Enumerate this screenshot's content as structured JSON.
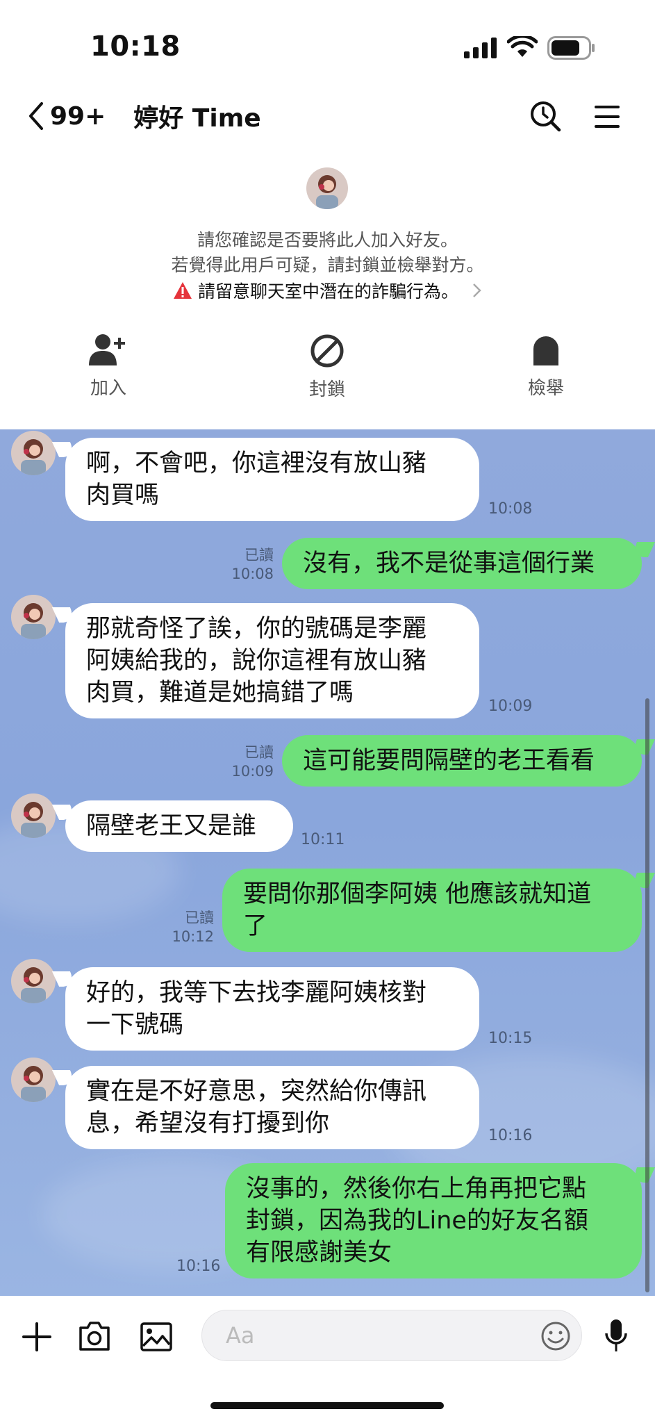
{
  "status_bar": {
    "time": "10:18"
  },
  "header": {
    "back_count": "99+",
    "title": "婷好 Time"
  },
  "notice": {
    "line1": "請您確認是否要將此人加入好友。",
    "line2": "若覺得此用戶可疑，請封鎖並檢舉對方。",
    "warning": "請留意聊天室中潛在的詐騙行為。"
  },
  "actions": {
    "add": "加入",
    "block": "封鎖",
    "report": "檢舉"
  },
  "messages": [
    {
      "side": "in",
      "text": "啊，不會吧，你這裡沒有放山豬\n肉買嗎",
      "time": "10:08"
    },
    {
      "side": "out",
      "text": "沒有，我不是從事這個行業",
      "read": "已讀",
      "time": "10:08"
    },
    {
      "side": "in",
      "text": "那就奇怪了誒，你的號碼是李麗\n阿姨給我的，說你這裡有放山豬\n肉買，難道是她搞錯了嗎",
      "time": "10:09"
    },
    {
      "side": "out",
      "text": "這可能要問隔壁的老王看看",
      "read": "已讀",
      "time": "10:09"
    },
    {
      "side": "in",
      "text": "隔壁老王又是誰",
      "time": "10:11"
    },
    {
      "side": "out",
      "text": "要問你那個李阿姨 他應該就知道\n了",
      "read": "已讀",
      "time": "10:12"
    },
    {
      "side": "in",
      "text": "好的，我等下去找李麗阿姨核對\n一下號碼",
      "time": "10:15"
    },
    {
      "side": "in",
      "text": "實在是不好意思，突然給你傳訊\n息，希望沒有打擾到你",
      "time": "10:16"
    },
    {
      "side": "out",
      "text": "沒事的，然後你右上角再把它點\n封鎖，因為我的Line的好友名額\n有限感謝美女",
      "time": "10:16"
    }
  ],
  "input": {
    "placeholder": "Aa"
  },
  "colors": {
    "chat_bg": "#8aa6dc",
    "outgoing_bubble": "#6ee07a",
    "incoming_bubble": "#ffffff",
    "warning": "#e5333b"
  }
}
